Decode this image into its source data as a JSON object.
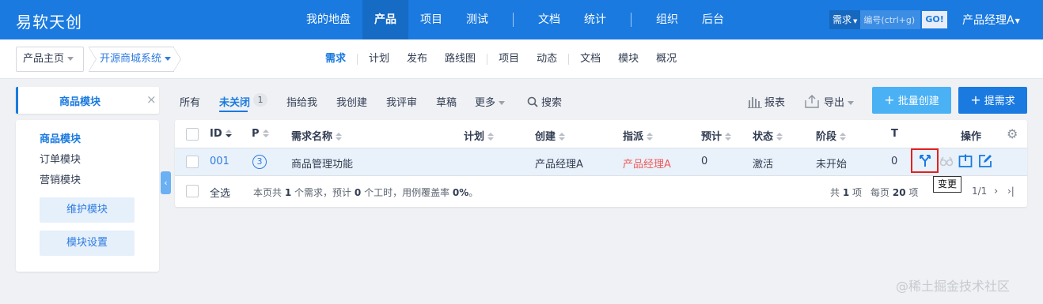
{
  "header": {
    "logo": "易软天创",
    "nav": [
      "我的地盘",
      "产品",
      "项目",
      "测试",
      "文档",
      "统计",
      "组织",
      "后台"
    ],
    "search_type": "需求",
    "search_placeholder": "编号(ctrl+g)",
    "search_go": "GO!",
    "user": "产品经理A"
  },
  "subheader": {
    "crumb_home": "产品主页",
    "crumb_product": "开源商城系统",
    "nav": [
      "需求",
      "计划",
      "发布",
      "路线图",
      "项目",
      "动态",
      "文档",
      "模块",
      "概况"
    ]
  },
  "module_tab": {
    "label": "商品模块",
    "close": "×"
  },
  "modules": [
    "商品模块",
    "订单模块",
    "营销模块"
  ],
  "module_buttons": {
    "maintain": "维护模块",
    "settings": "模块设置"
  },
  "toolbar": {
    "all": "所有",
    "unclosed": "未关闭",
    "unclosed_count": "1",
    "assigned": "指给我",
    "created": "我创建",
    "review": "我评审",
    "draft": "草稿",
    "more": "更多",
    "search": "搜索",
    "report": "报表",
    "export": "导出",
    "batch_create": "批量创建",
    "create": "提需求"
  },
  "table": {
    "headers": {
      "id": "ID",
      "pri": "P",
      "title": "需求名称",
      "plan": "计划",
      "creator": "创建",
      "assignee": "指派",
      "estimate": "预计",
      "status": "状态",
      "stage": "阶段",
      "t": "T",
      "actions": "操作"
    },
    "row": {
      "id": "001",
      "pri": "3",
      "title": "商品管理功能",
      "creator": "产品经理A",
      "assignee": "产品经理A",
      "estimate": "0",
      "status": "激活",
      "stage": "未开始",
      "t": "0"
    },
    "tooltip": "变更",
    "footer": {
      "select_all": "全选",
      "summary_prefix": "本页共",
      "summary_count": "1",
      "summary_mid1": "个需求，预计",
      "summary_hours": "0",
      "summary_mid2": "个工时，用例覆盖率",
      "summary_coverage": "0%",
      "summary_end": "。",
      "total_prefix": "共",
      "total_count": "1",
      "total_suffix": "项",
      "per_page_prefix": "每页",
      "per_page": "20",
      "per_page_suffix": "项",
      "page": "1/1"
    }
  },
  "watermark": "@稀土掘金技术社区",
  "colors": {
    "primary": "#1a7ae0",
    "assignee_red": "#f15a5a",
    "highlight": "#e61f1f"
  }
}
